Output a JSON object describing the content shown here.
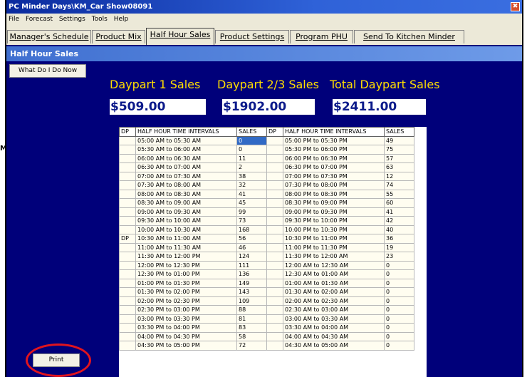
{
  "window": {
    "title": "PC Minder  Days\\KM_Car Show08091",
    "close_glyph": "✖"
  },
  "menu": [
    "File",
    "Forecast",
    "Settings",
    "Tools",
    "Help"
  ],
  "tabs": [
    "Manager's Schedule",
    "Product Mix",
    "Half Hour Sales",
    "Product Settings",
    "Program PHU",
    "Send To Kitchen Minder"
  ],
  "active_tab": "Half Hour Sales",
  "panel_title": "Half Hour Sales",
  "help_button": "What Do I Do Now",
  "side_fragment": "M",
  "daypart": {
    "dp1_label": "Daypart 1 Sales",
    "dp23_label": "Daypart 2/3 Sales",
    "total_label": "Total Daypart Sales",
    "dp1_value": "$509.00",
    "dp23_value": "$1902.00",
    "total_value": "$2411.00"
  },
  "table": {
    "headers": [
      "DP",
      "HALF HOUR TIME INTERVALS",
      "SALES",
      "DP",
      "HALF HOUR TIME INTERVALS",
      "SALES"
    ],
    "left_rows": [
      [
        "",
        "05:00 AM to 05:30 AM",
        "0"
      ],
      [
        "",
        "05:30 AM to 06:00 AM",
        "0"
      ],
      [
        "",
        "06:00 AM to 06:30 AM",
        "11"
      ],
      [
        "",
        "06:30 AM to 07:00 AM",
        "2"
      ],
      [
        "",
        "07:00 AM to 07:30 AM",
        "38"
      ],
      [
        "",
        "07:30 AM to 08:00 AM",
        "32"
      ],
      [
        "",
        "08:00 AM to 08:30 AM",
        "41"
      ],
      [
        "",
        "08:30 AM to 09:00 AM",
        "45"
      ],
      [
        "",
        "09:00 AM to 09:30 AM",
        "99"
      ],
      [
        "",
        "09:30 AM to 10:00 AM",
        "73"
      ],
      [
        "",
        "10:00 AM to 10:30 AM",
        "168"
      ],
      [
        "DP",
        "10:30 AM to 11:00 AM",
        "56"
      ],
      [
        "",
        "11:00 AM to 11:30 AM",
        "46"
      ],
      [
        "",
        "11:30 AM to 12:00 PM",
        "124"
      ],
      [
        "",
        "12:00 PM to 12:30 PM",
        "111"
      ],
      [
        "",
        "12:30 PM to 01:00 PM",
        "136"
      ],
      [
        "",
        "01:00 PM to 01:30 PM",
        "149"
      ],
      [
        "",
        "01:30 PM to 02:00 PM",
        "143"
      ],
      [
        "",
        "02:00 PM to 02:30 PM",
        "109"
      ],
      [
        "",
        "02:30 PM to 03:00 PM",
        "88"
      ],
      [
        "",
        "03:00 PM to 03:30 PM",
        "81"
      ],
      [
        "",
        "03:30 PM to 04:00 PM",
        "83"
      ],
      [
        "",
        "04:00 PM to 04:30 PM",
        "58"
      ],
      [
        "",
        "04:30 PM to 05:00 PM",
        "72"
      ]
    ],
    "right_rows": [
      [
        "",
        "05:00 PM to 05:30 PM",
        "49"
      ],
      [
        "",
        "05:30 PM to 06:00 PM",
        "75"
      ],
      [
        "",
        "06:00 PM to 06:30 PM",
        "57"
      ],
      [
        "",
        "06:30 PM to 07:00 PM",
        "63"
      ],
      [
        "",
        "07:00 PM to 07:30 PM",
        "12"
      ],
      [
        "",
        "07:30 PM to 08:00 PM",
        "74"
      ],
      [
        "",
        "08:00 PM to 08:30 PM",
        "55"
      ],
      [
        "",
        "08:30 PM to 09:00 PM",
        "60"
      ],
      [
        "",
        "09:00 PM to 09:30 PM",
        "41"
      ],
      [
        "",
        "09:30 PM to 10:00 PM",
        "42"
      ],
      [
        "",
        "10:00 PM to 10:30 PM",
        "40"
      ],
      [
        "",
        "10:30 PM to 11:00 PM",
        "36"
      ],
      [
        "",
        "11:00 PM to 11:30 PM",
        "19"
      ],
      [
        "",
        "11:30 PM to 12:00 AM",
        "23"
      ],
      [
        "",
        "12:00 AM to 12:30 AM",
        "0"
      ],
      [
        "",
        "12:30 AM to 01:00 AM",
        "0"
      ],
      [
        "",
        "01:00 AM to 01:30 AM",
        "0"
      ],
      [
        "",
        "01:30 AM to 02:00 AM",
        "0"
      ],
      [
        "",
        "02:00 AM to 02:30 AM",
        "0"
      ],
      [
        "",
        "02:30 AM to 03:00 AM",
        "0"
      ],
      [
        "",
        "03:00 AM to 03:30 AM",
        "0"
      ],
      [
        "",
        "03:30 AM to 04:00 AM",
        "0"
      ],
      [
        "",
        "04:00 AM to 04:30 AM",
        "0"
      ],
      [
        "",
        "04:30 AM to 05:00 AM",
        "0"
      ]
    ],
    "selected_cell": "left-0-sales"
  },
  "print_button": "Print",
  "colors": {
    "window_bg": "#00007a",
    "heading": "#ffdd00",
    "value_text": "#0b1a8a",
    "annotation_circle": "#e0141e"
  }
}
